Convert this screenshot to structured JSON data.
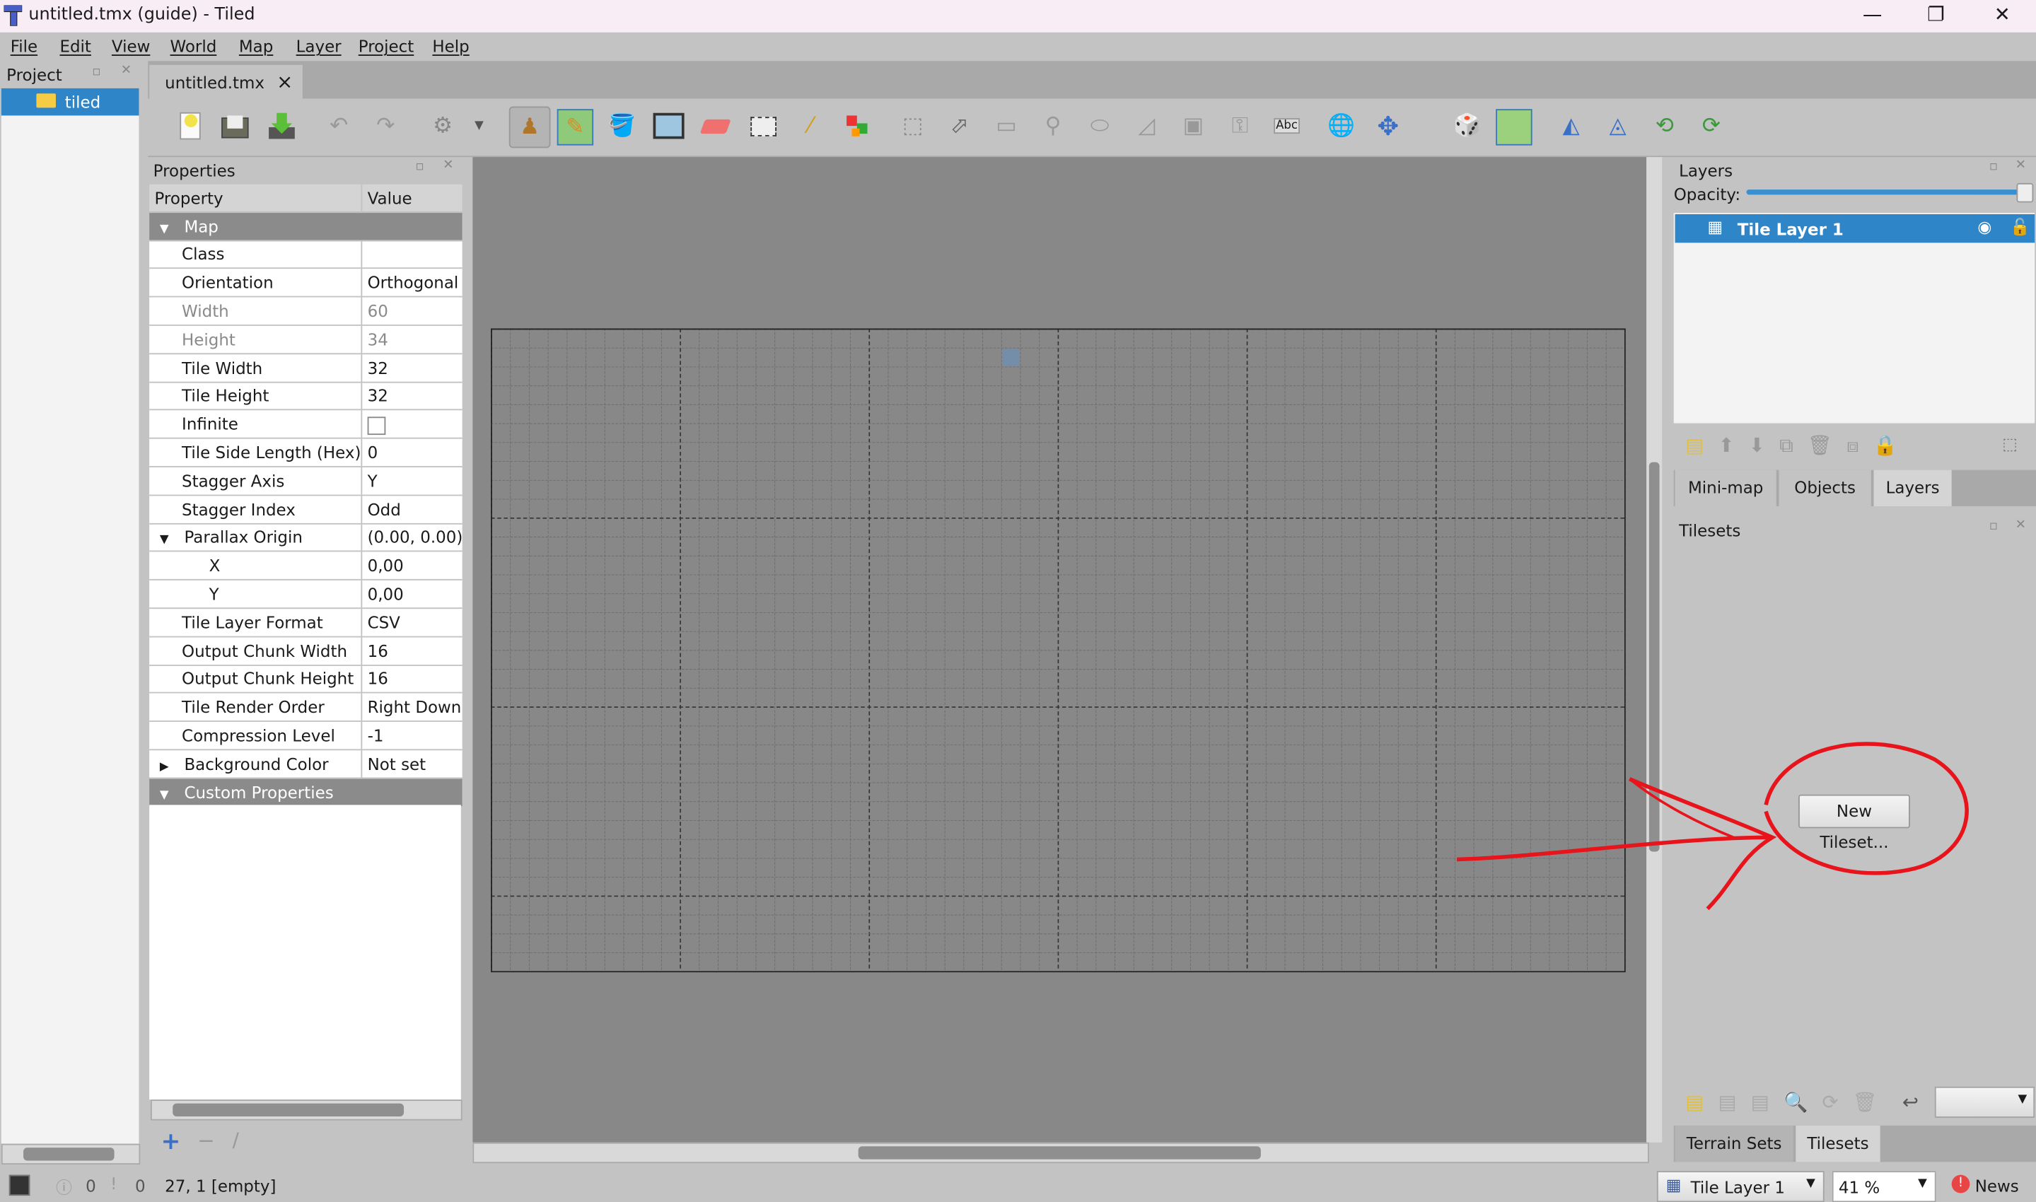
{
  "window": {
    "title": "untitled.tmx (guide) - Tiled",
    "controls": [
      "minimize",
      "restore",
      "close"
    ]
  },
  "menu": [
    "File",
    "Edit",
    "View",
    "World",
    "Map",
    "Layer",
    "Project",
    "Help"
  ],
  "project_panel": {
    "title": "Project",
    "items": [
      "tiled"
    ]
  },
  "document_tab": {
    "label": "untitled.tmx",
    "close": "×"
  },
  "toolbar": {
    "icons": [
      "new-map",
      "open",
      "save",
      "undo",
      "redo",
      "commands",
      "stamp-brush",
      "terrain-brush",
      "bucket-fill",
      "shape-fill",
      "eraser",
      "rect-select",
      "magic-wand",
      "select-same-tile",
      "select-objects",
      "edit-polygons",
      "insert-rectangle",
      "insert-point",
      "insert-ellipse",
      "insert-polygon",
      "insert-tile",
      "insert-template",
      "insert-text",
      "world-tool",
      "move",
      "random-mode",
      "wang-fill",
      "flip-horizontal",
      "flip-vertical",
      "rotate-left",
      "rotate-right"
    ],
    "text_tool_label": "Abc"
  },
  "properties": {
    "title": "Properties",
    "columns": [
      "Property",
      "Value"
    ],
    "group_map": "Map",
    "rows": [
      {
        "name": "Class",
        "value": ""
      },
      {
        "name": "Orientation",
        "value": "Orthogonal"
      },
      {
        "name": "Width",
        "value": "60",
        "disabled": true
      },
      {
        "name": "Height",
        "value": "34",
        "disabled": true
      },
      {
        "name": "Tile Width",
        "value": "32"
      },
      {
        "name": "Tile Height",
        "value": "32"
      },
      {
        "name": "Infinite",
        "value": "",
        "checkbox": false
      },
      {
        "name": "Tile Side Length (Hex)",
        "value": "0"
      },
      {
        "name": "Stagger Axis",
        "value": "Y"
      },
      {
        "name": "Stagger Index",
        "value": "Odd"
      },
      {
        "name": "Parallax Origin",
        "value": "(0.00, 0.00)",
        "expanded": true
      },
      {
        "name": "X",
        "value": "0,00",
        "child": true
      },
      {
        "name": "Y",
        "value": "0,00",
        "child": true
      },
      {
        "name": "Tile Layer Format",
        "value": "CSV"
      },
      {
        "name": "Output Chunk Width",
        "value": "16"
      },
      {
        "name": "Output Chunk Height",
        "value": "16"
      },
      {
        "name": "Tile Render Order",
        "value": "Right Down"
      },
      {
        "name": "Compression Level",
        "value": "-1"
      },
      {
        "name": "Background Color",
        "value": "Not set",
        "collapsed": true
      }
    ],
    "group_custom": "Custom Properties"
  },
  "map": {
    "width_tiles": 60,
    "height_tiles": 34,
    "highlighted_tile": [
      27,
      1
    ]
  },
  "layers": {
    "title": "Layers",
    "opacity_label": "Opacity:",
    "opacity": 1.0,
    "items": [
      {
        "name": "Tile Layer 1",
        "visible": true,
        "locked": false
      }
    ]
  },
  "right_tabs": [
    "Mini-map",
    "Objects",
    "Layers"
  ],
  "tilesets": {
    "title": "Tilesets",
    "new_button": "New Tileset...",
    "tabs": [
      "Terrain Sets",
      "Tilesets"
    ]
  },
  "status": {
    "errors": "0",
    "warnings": "0",
    "position": "27, 1 [empty]",
    "layer": "Tile Layer 1",
    "zoom": "41 %",
    "news": "News"
  },
  "annotation_color": "#e8141c"
}
